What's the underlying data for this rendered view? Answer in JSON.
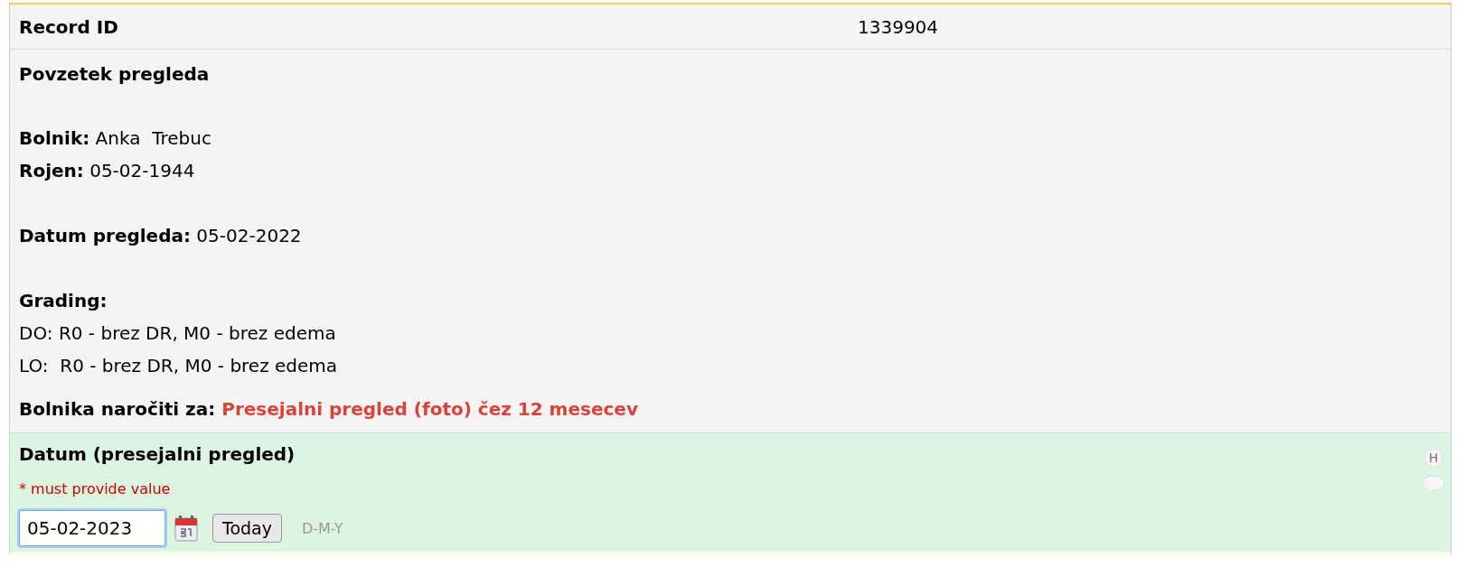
{
  "record": {
    "label": "Record ID",
    "value": "1339904"
  },
  "summary": {
    "title": "Povzetek pregleda",
    "blocks": [
      [
        "**Bolnik:** Anka  Trebuc",
        "**Rojen:** 05-02-1944"
      ],
      [
        "**Datum pregleda:** 05-02-2022"
      ],
      [
        "**Grading:**",
        "DO: R0 - brez DR, M0 - brez edema",
        "LO:  R0 - brez DR, M0 - brez edema"
      ]
    ],
    "order": {
      "label": "Bolnika naročiti za:",
      "value": "Presejalni pregled (foto) čez 12 mesecev"
    }
  },
  "field": {
    "label": "Datum (presejalni pregled)",
    "required_note": "* must provide value",
    "value": "05-02-2023",
    "today_button": "Today",
    "format_hint": "D-M-Y",
    "history_icon": "H"
  }
}
